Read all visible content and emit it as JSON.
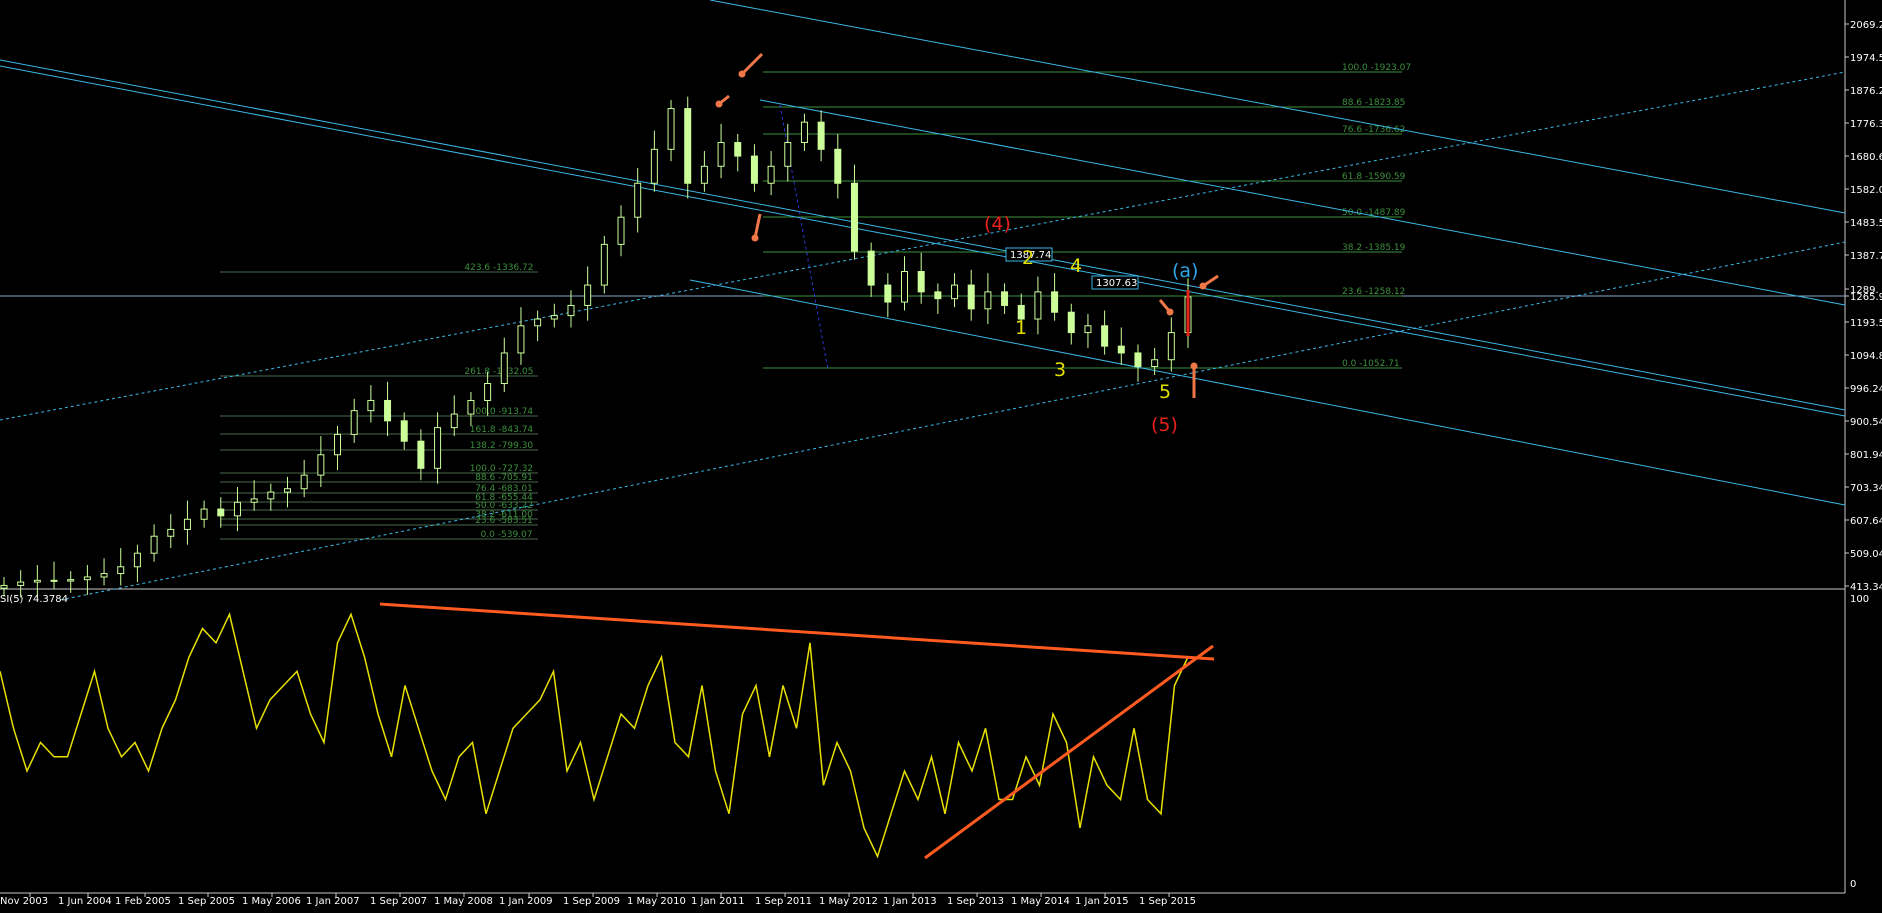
{
  "chart_data": [
    {
      "type": "candlestick",
      "title": "",
      "header_text": "",
      "price_levels": [
        "2069.24",
        "1974.51",
        "1876.24",
        "1776.35",
        "1680.60",
        "1582.00",
        "1483.54",
        "1387.72",
        "1289.",
        "1265.96",
        "1193.54",
        "1094.83",
        "996.24",
        "900.54",
        "801.94",
        "703.34",
        "607.64",
        "509.04",
        "413.34"
      ],
      "x_tick_labels": [
        "Nov 2003",
        "1 Jun 2004",
        "1 Feb 2005",
        "1 Sep 2005",
        "1 May 2006",
        "1 Jan 2007",
        "1 Sep 2007",
        "1 May 2008",
        "1 Jan 2009",
        "1 Sep 2009",
        "1 May 2010",
        "1 Jan 2011",
        "1 Sep 2011",
        "1 May 2012",
        "1 Jan 2013",
        "1 Sep 2013",
        "1 May 2014",
        "1 Jan 2015",
        "1 Sep 2015"
      ],
      "current_price_label": "1265.96",
      "close_series_approx": [
        415,
        425,
        430,
        428,
        432,
        440,
        450,
        470,
        510,
        560,
        580,
        610,
        640,
        620,
        660,
        670,
        690,
        700,
        740,
        800,
        860,
        930,
        960,
        900,
        840,
        760,
        880,
        920,
        960,
        1010,
        1100,
        1180,
        1200,
        1210,
        1240,
        1300,
        1420,
        1500,
        1600,
        1700,
        1820,
        1600,
        1650,
        1720,
        1680,
        1600,
        1650,
        1720,
        1780,
        1700,
        1600,
        1400,
        1300,
        1250,
        1340,
        1280,
        1260,
        1300,
        1230,
        1280,
        1240,
        1200,
        1280,
        1220,
        1160,
        1180,
        1120,
        1100,
        1060,
        1080,
        1160,
        1265
      ],
      "fib_sets": [
        {
          "levels": [
            "100.0 -1923.07",
            "88.6 -1823.85",
            "76.6 -1736.62",
            "61.8 -1590.59",
            "50.0 -1487.89",
            "38.2 -1385.19",
            "23.6 -1258.12",
            "0.0 -1052.71"
          ]
        },
        {
          "levels": [
            "423.6 -1336.72",
            "261.8 -1032.05",
            "200.0 -913.74",
            "161.8 -843.74",
            "138.2 -799.30",
            "100.0 -727.32",
            "88.6 -705.91",
            "76.4 -683.01",
            "61.8 -655.44",
            "50.0 -633.22",
            "38.2 -611.00",
            "23.6 -583.51",
            "0.0 -539.07"
          ]
        }
      ],
      "value_boxes": [
        "1387.74",
        "1307.63"
      ],
      "wave_labels": [
        {
          "text": "(4)",
          "color": "#e8211b"
        },
        {
          "text": "(5)",
          "color": "#e8211b"
        },
        {
          "text": "(a)",
          "color": "#2ea7e8"
        },
        {
          "text": "1",
          "color": "#e4e000"
        },
        {
          "text": "2",
          "color": "#e4e000"
        },
        {
          "text": "3",
          "color": "#e4e000"
        },
        {
          "text": "4",
          "color": "#e4e000"
        },
        {
          "text": "5",
          "color": "#e4e000"
        }
      ],
      "colors": {
        "background": "#000000",
        "candle": "#ccff99",
        "channel": "#3cb8e8",
        "fib": "#3d8f3d",
        "trend": "#ff5a1f",
        "arrow": "#f07848"
      }
    },
    {
      "type": "line",
      "indicator_label": "SI(5) 74.3784",
      "ylim": [
        0,
        100
      ],
      "y_tick_labels": [
        "100",
        "0"
      ],
      "values_approx": [
        75,
        55,
        40,
        50,
        45,
        45,
        60,
        75,
        55,
        45,
        50,
        40,
        55,
        65,
        80,
        90,
        85,
        95,
        75,
        55,
        65,
        70,
        75,
        60,
        50,
        85,
        95,
        80,
        60,
        45,
        70,
        55,
        40,
        30,
        45,
        50,
        25,
        40,
        55,
        60,
        65,
        75,
        40,
        50,
        30,
        45,
        60,
        55,
        70,
        80,
        50,
        45,
        70,
        40,
        25,
        60,
        70,
        45,
        70,
        55,
        85,
        35,
        50,
        40,
        20,
        10,
        25,
        40,
        30,
        45,
        25,
        50,
        40,
        55,
        30,
        30,
        45,
        35,
        60,
        50,
        20,
        45,
        35,
        30,
        55,
        30,
        25,
        70,
        80
      ],
      "trendlines": [
        "descending resistance",
        "ascending support"
      ],
      "line_color": "#e8e000",
      "trend_color": "#ff5a1f"
    }
  ]
}
